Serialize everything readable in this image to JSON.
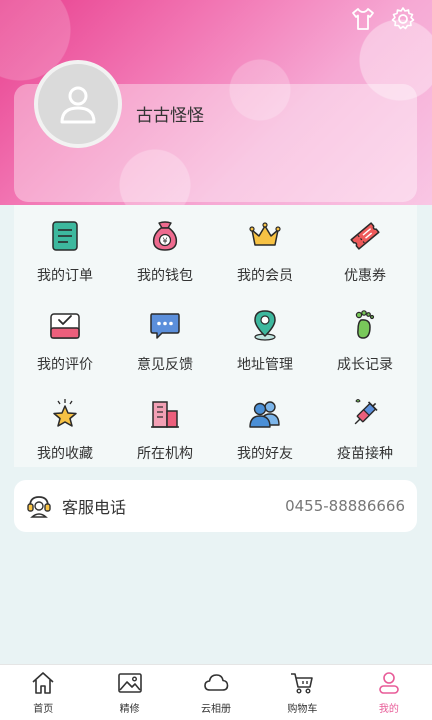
{
  "header": {
    "username": "古古怪怪"
  },
  "menu": [
    {
      "label": "我的订单",
      "icon": "order-icon"
    },
    {
      "label": "我的钱包",
      "icon": "wallet-icon"
    },
    {
      "label": "我的会员",
      "icon": "crown-icon"
    },
    {
      "label": "优惠券",
      "icon": "coupon-icon"
    },
    {
      "label": "我的评价",
      "icon": "review-icon"
    },
    {
      "label": "意见反馈",
      "icon": "feedback-icon"
    },
    {
      "label": "地址管理",
      "icon": "location-icon"
    },
    {
      "label": "成长记录",
      "icon": "footprint-icon"
    },
    {
      "label": "我的收藏",
      "icon": "star-icon"
    },
    {
      "label": "所在机构",
      "icon": "building-icon"
    },
    {
      "label": "我的好友",
      "icon": "friends-icon"
    },
    {
      "label": "疫苗接种",
      "icon": "syringe-icon"
    }
  ],
  "service": {
    "label": "客服电话",
    "phone": "0455-88886666"
  },
  "tabs": [
    {
      "label": "首页",
      "icon": "home-icon"
    },
    {
      "label": "精修",
      "icon": "image-icon"
    },
    {
      "label": "云相册",
      "icon": "cloud-icon"
    },
    {
      "label": "购物车",
      "icon": "cart-icon"
    },
    {
      "label": "我的",
      "icon": "user-icon"
    }
  ],
  "colors": {
    "accent": "#e85c98",
    "hero_start": "#e83f8e",
    "hero_end": "#f9c6e4",
    "background": "#e9f3f4"
  }
}
